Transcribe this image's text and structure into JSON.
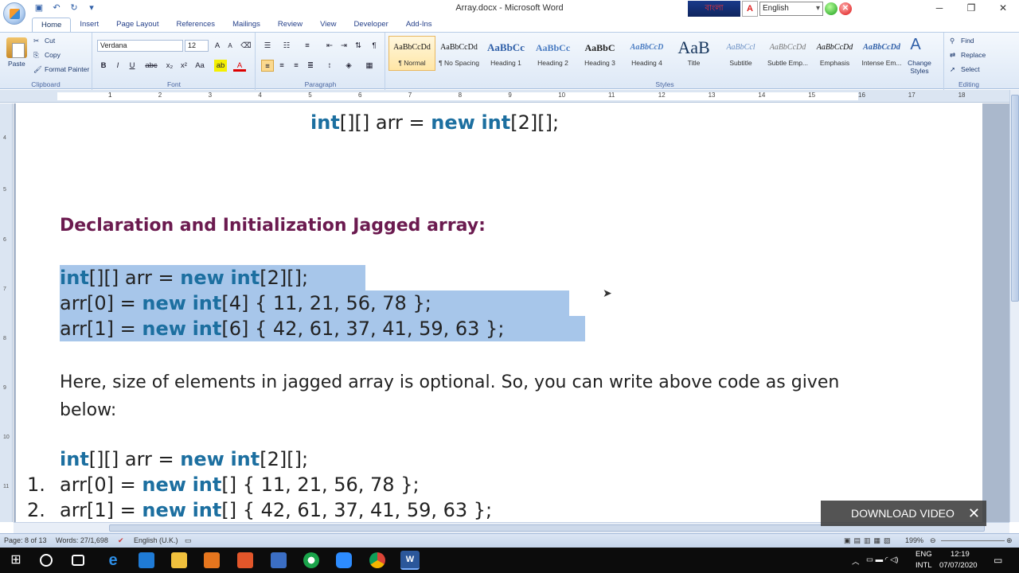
{
  "window": {
    "title": "Array.docx - Microsoft Word"
  },
  "extensions": {
    "bangla_label": "বাংলা",
    "language": "English"
  },
  "ribbon": {
    "tabs": [
      "Home",
      "Insert",
      "Page Layout",
      "References",
      "Mailings",
      "Review",
      "View",
      "Developer",
      "Add-Ins"
    ],
    "clipboard": {
      "paste": "Paste",
      "cut": "Cut",
      "copy": "Copy",
      "format_painter": "Format Painter",
      "label": "Clipboard"
    },
    "font": {
      "name": "Verdana",
      "size": "12",
      "label": "Font"
    },
    "paragraph": {
      "label": "Paragraph"
    },
    "styles": {
      "label": "Styles",
      "items": [
        {
          "sample": "AaBbCcDd",
          "name": "¶ Normal"
        },
        {
          "sample": "AaBbCcDd",
          "name": "¶ No Spacing"
        },
        {
          "sample": "AaBbCc",
          "name": "Heading 1"
        },
        {
          "sample": "AaBbCc",
          "name": "Heading 2"
        },
        {
          "sample": "AaBbC",
          "name": "Heading 3"
        },
        {
          "sample": "AaBbCcD",
          "name": "Heading 4"
        },
        {
          "sample": "AaB",
          "name": "Title"
        },
        {
          "sample": "AaBbCcl",
          "name": "Subtitle"
        },
        {
          "sample": "AaBbCcDd",
          "name": "Subtle Emp..."
        },
        {
          "sample": "AaBbCcDd",
          "name": "Emphasis"
        },
        {
          "sample": "AaBbCcDd",
          "name": "Intense Em..."
        }
      ],
      "change_styles": "Change Styles"
    },
    "editing": {
      "find": "Find",
      "replace": "Replace",
      "select": "Select",
      "label": "Editing"
    }
  },
  "ruler": {
    "marks": [
      "1",
      "1",
      "2",
      "3",
      "4",
      "5",
      "6",
      "7",
      "8",
      "9",
      "10",
      "11",
      "12",
      "13",
      "14",
      "15",
      "16",
      "17",
      "18"
    ]
  },
  "document": {
    "top_code": {
      "kw1": "int",
      "p1": "[][] arr = ",
      "kw2": "new",
      "sp": " ",
      "kw3": "int",
      "p2": "[2][];"
    },
    "heading": "Declaration and Initialization Jagged array:",
    "block1": [
      {
        "a": "int",
        "b": "[][] arr = ",
        "c": "new",
        "d": "int",
        "e": "[2][];",
        "pre": ""
      },
      {
        "pre": "arr[0] = ",
        "c": "new",
        "d": "int",
        "e": "[4] { 11, 21, 56, 78 };"
      },
      {
        "pre": "arr[1] = ",
        "c": "new",
        "d": "int",
        "e": "[6] { 42, 61, 37, 41, 59, 63 };"
      }
    ],
    "paragraph": "Here, size of elements in jagged array is optional. So, you can write above code as given below:",
    "block2": [
      {
        "pre": "",
        "a": "int",
        "b": "[][] arr = ",
        "c": "new",
        "d": "int",
        "e": "[2][];"
      },
      {
        "num": "1.",
        "pre": "arr[0] = ",
        "c": "new",
        "d": "int",
        "e": "[] { 11, 21, 56, 78 };"
      },
      {
        "num": "2.",
        "pre": "arr[1] = ",
        "c": "new",
        "d": "int",
        "e": "[] { 42, 61, 37, 41, 59, 63 };"
      }
    ]
  },
  "overlay": {
    "download": "DOWNLOAD VIDEO"
  },
  "status": {
    "page": "Page: 8 of 13",
    "words": "Words: 27/1,698",
    "language": "English (U.K.)",
    "zoom": "199%"
  },
  "taskbar": {
    "lang1": "ENG",
    "lang2": "INTL",
    "time": "12:19",
    "date": "07/07/2020"
  }
}
